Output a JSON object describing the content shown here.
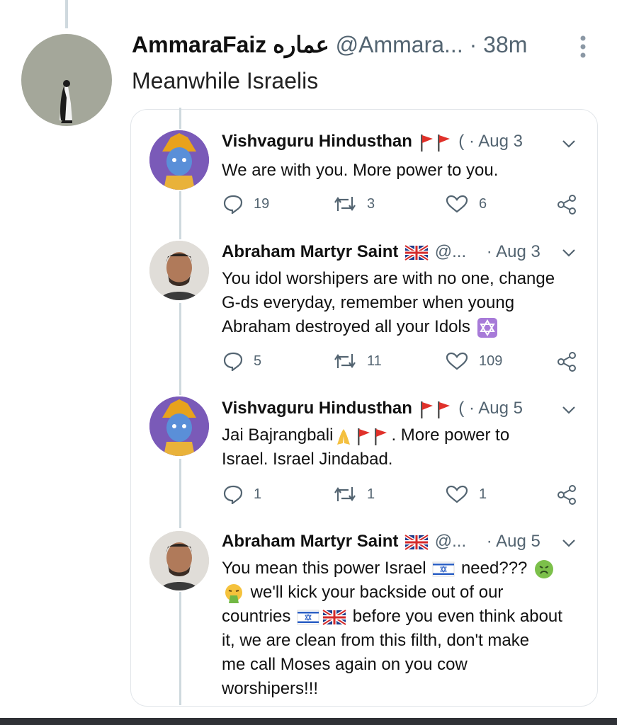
{
  "tweet": {
    "author_name": "AmmaraFaiz",
    "author_name_arabic": "عماره",
    "handle": "@Ammara...",
    "time": "· 38m",
    "text": "Meanwhile Israelis"
  },
  "replies": [
    {
      "name": "Vishvaguru Hindusthan",
      "handle_fragment": "(",
      "date": "· Aug 3",
      "lines": [
        "We are with you. More power to you."
      ],
      "replies": "19",
      "retweets": "3",
      "likes": "6"
    },
    {
      "name": "Abraham Martyr Saint",
      "handle_fragment": "@...",
      "date": "· Aug 3",
      "lines": [
        "You idol worshipers are with no one, change",
        "G-ds everyday, remember when young",
        "Abraham destroyed all your Idols"
      ],
      "replies": "5",
      "retweets": "11",
      "likes": "109"
    },
    {
      "name": "Vishvaguru Hindusthan",
      "handle_fragment": "(",
      "date": "· Aug 5",
      "lines": [
        "Jai Bajrangbali",
        ". More power to",
        "Israel.  Israel Jindabad."
      ],
      "replies": "1",
      "retweets": "1",
      "likes": "1"
    },
    {
      "name": "Abraham Martyr Saint",
      "handle_fragment": "@...",
      "date": "· Aug 5",
      "lines": [
        "You mean this power Israel",
        "need???",
        "we'll kick your backside out of our",
        "countries",
        "before you even think about",
        "it, we are clean from this filth, don't make",
        "me call Moses again on you cow",
        "worshipers!!!"
      ]
    }
  ],
  "colors": {
    "muted": "#536471",
    "line": "#cfd9de",
    "flag_red": "#e0312a"
  }
}
